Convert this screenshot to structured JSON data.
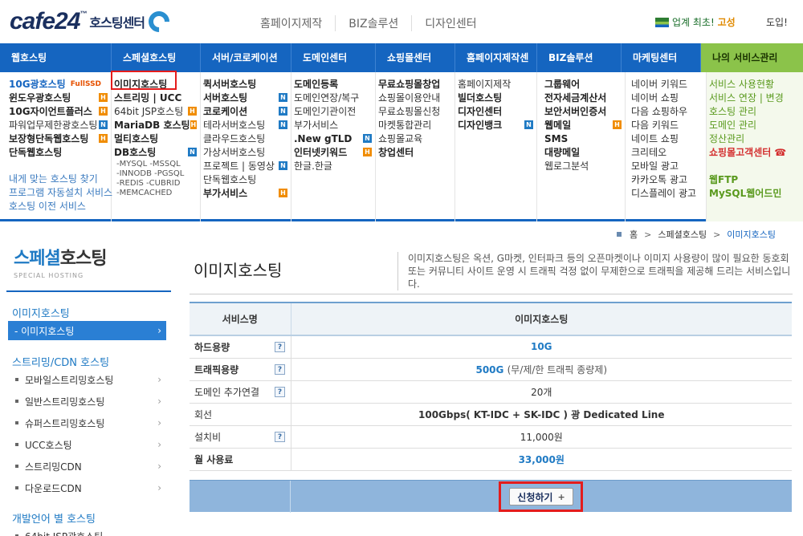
{
  "header": {
    "logo_text": "cafe24",
    "logo_tm": "™",
    "logo_sub": "호스팅센터",
    "top_links": [
      "홈페이지제작",
      "BIZ솔루션",
      "디자인센터"
    ],
    "best_text": "업계 최초!",
    "best_highlight": "고성",
    "help": "도입!"
  },
  "gnb": [
    "웹호스팅",
    "스페셜호스팅",
    "서버/코로케이션",
    "도메인센터",
    "쇼핑몰센터",
    "홈페이지제작센터",
    "BIZ솔루션",
    "마케팅센터",
    "나의 서비스관리"
  ],
  "mega": {
    "col1": [
      "10G광호스팅",
      "FullSSD",
      "윈도우광호스팅",
      "10G자이언트플러스",
      "파워업무제한광호스팅",
      "보장형단독웹호스팅",
      "단독웹호스팅",
      "내게 맞는 호스팅 찾기",
      "프로그램 자동설치 서비스",
      "호스팅 이전 서비스"
    ],
    "col2": [
      "이미지호스팅",
      "스트리밍 | UCC",
      "64bit JSP호스팅",
      "MariaDB 호스팅",
      "멀티호스팅",
      "DB호스팅",
      "-MYSQL -MSSQL",
      "-INNODB -PGSQL",
      "-REDIS -CUBRID",
      "-MEMCACHED"
    ],
    "col3": [
      "퀵서버호스팅",
      "서버호스팅",
      "코로케이션",
      "테라서버호스팅",
      "클라우드호스팅",
      "가상서버호스팅",
      "프로젝트 | 동영상",
      "단독웹호스팅",
      "부가서비스"
    ],
    "col4": [
      "도메인등록",
      "도메인연장/복구",
      "도메인기관이전",
      "부가서비스",
      ".New gTLD",
      "인터넷키워드",
      "한글.한글"
    ],
    "col5": [
      "무료쇼핑몰창업",
      "쇼핑몰이용안내",
      "무료쇼핑몰신청",
      "마켓통합관리",
      "쇼핑몰교육",
      "창업센터"
    ],
    "col6": [
      "홈페이지제작",
      "빌더호스팅",
      "디자인센터",
      "디자인뱅크"
    ],
    "col7": [
      "그룹웨어",
      "전자세금계산서",
      "보안서버인증서",
      "웹메일",
      "SMS",
      "대량메일",
      "웹로그분석"
    ],
    "col8": [
      "네이버 키워드",
      "네이버 쇼핑",
      "다음 쇼핑하우",
      "다음 키워드",
      "네이트 쇼핑",
      "크리테오",
      "모바일 광고",
      "카카오톡 광고",
      "디스플레이 광고"
    ],
    "col9": [
      "서비스 사용현황",
      "서비스 연장 | 변경",
      "호스팅 관리",
      "도메인 관리",
      "정산관리",
      "쇼핑몰고객센터",
      "웹FTP",
      "MySQL웹어드민"
    ],
    "badge_h": "H",
    "badge_n": "N",
    "phone_icon": "☎"
  },
  "breadcrumb": [
    "홈",
    "스페셜호스팅",
    "이미지호스팅"
  ],
  "sidebar": {
    "title_accent": "스페셜",
    "title_rest": "호스팅",
    "subtitle": "SPECIAL HOSTING",
    "cat1": "이미지호스팅",
    "active": "- 이미지호스팅",
    "cat2": "스트리밍/CDN 호스팅",
    "items": [
      "모바일스트리밍호스팅",
      "일반스트리밍호스팅",
      "슈퍼스트리밍호스팅",
      "UCC호스팅",
      "스트리밍CDN",
      "다운로드CDN"
    ],
    "cat3": "개발언어 별 호스팅",
    "partial": "64bit JSP광호스팅",
    "chevron": "›"
  },
  "content": {
    "title": "이미지호스팅",
    "description": "이미지호스팅은 옥션, G마켓, 인터파크 등의 오픈마켓이나 이미지 사용량이 많이 필요한 동호회 또는 커뮤니티 사이트 운영 시 트래픽 걱정 없이 무제한으로 트래픽을 제공해 드리는 서비스입니다.",
    "table": {
      "head_label": "서비스명",
      "head_value": "이미지호스팅",
      "help_icon": "?",
      "rows": [
        {
          "label": "하드용량",
          "value": "10G"
        },
        {
          "label": "트래픽용량",
          "value": "500G",
          "note": "(무/제/한 트래픽 종량제)"
        },
        {
          "label": "도메인 추가연결",
          "value": "20개"
        },
        {
          "label": "회선",
          "value": "100Gbps( KT-IDC + SK-IDC ) 광 Dedicated Line"
        },
        {
          "label": "설치비",
          "value": "11,000원"
        },
        {
          "label": "월 사용료",
          "value": "33,000원"
        }
      ]
    },
    "apply_button": "신청하기",
    "apply_plus": "+"
  }
}
